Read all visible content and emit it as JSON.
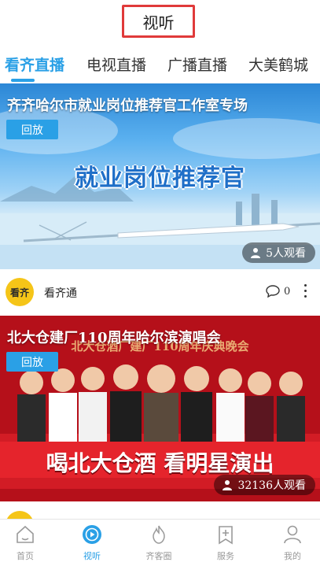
{
  "header": {
    "title": "视听"
  },
  "tabs": [
    {
      "label": "看齐直播",
      "active": true
    },
    {
      "label": "电视直播",
      "active": false
    },
    {
      "label": "广播直播",
      "active": false
    },
    {
      "label": "大美鹤城",
      "active": false
    }
  ],
  "cards": [
    {
      "title": "齐齐哈尔市就业岗位推荐官工作室专场",
      "replay_label": "回放",
      "banner_text": "就业岗位推荐官",
      "viewers": "5人观看"
    },
    {
      "title": "北大仓建厂110周年哈尔滨演唱会",
      "replay_label": "回放",
      "banner_text": "北大仓酒厂建厂110周年庆典晚会",
      "slogan": "喝北大仓酒 看明星演出",
      "viewers": "32136人观看"
    }
  ],
  "author": {
    "avatar_text": "看齐",
    "name": "看齐通",
    "comment_count": "0"
  },
  "bottom_nav": [
    {
      "label": "首页",
      "icon": "home-icon",
      "active": false
    },
    {
      "label": "视听",
      "icon": "play-icon",
      "active": true
    },
    {
      "label": "齐客圈",
      "icon": "flame-icon",
      "active": false
    },
    {
      "label": "服务",
      "icon": "bookmark-plus-icon",
      "active": false
    },
    {
      "label": "我的",
      "icon": "person-icon",
      "active": false
    }
  ],
  "colors": {
    "accent": "#2aa0e6",
    "title_border": "#e03a3a"
  }
}
